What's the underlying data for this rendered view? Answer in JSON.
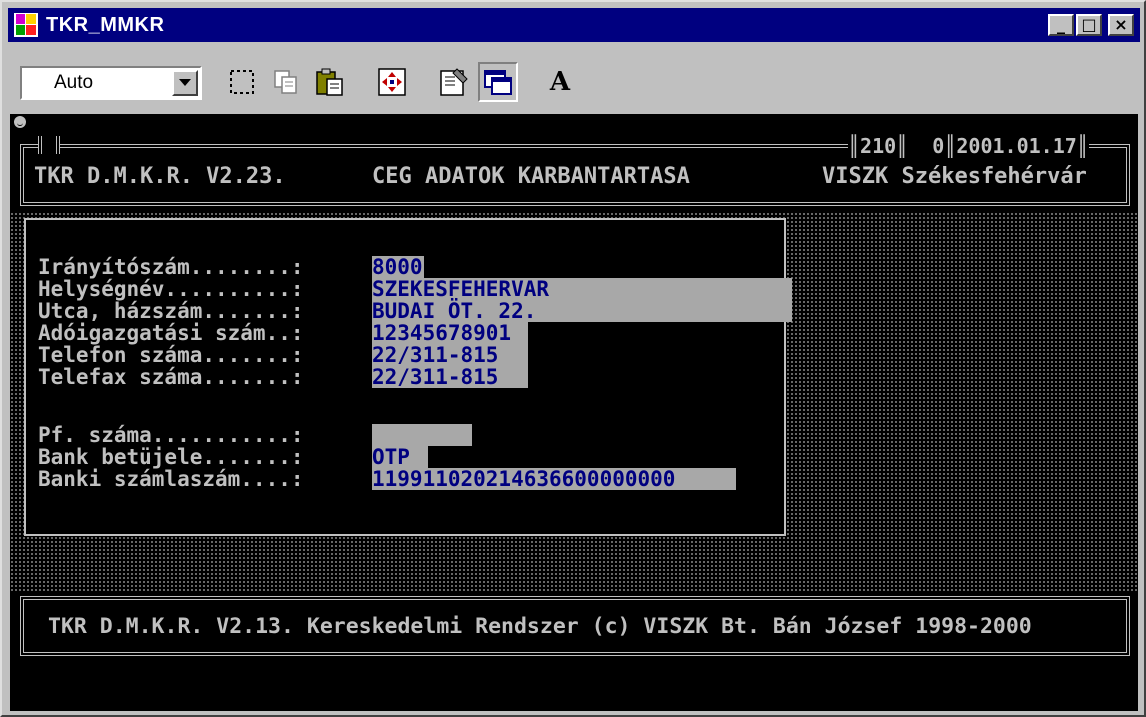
{
  "window": {
    "title": "TKR_MMKR",
    "minimize_glyph": "_",
    "maximize_glyph": "□",
    "close_glyph": "×"
  },
  "toolbar": {
    "font_combo_value": "Auto",
    "buttons": [
      {
        "name": "mark-icon"
      },
      {
        "name": "copy-icon"
      },
      {
        "name": "paste-icon"
      },
      {
        "name": "fullscreen-icon"
      },
      {
        "name": "properties-icon"
      },
      {
        "name": "background-icon",
        "pressed": true
      },
      {
        "name": "font-icon",
        "glyph": "A"
      }
    ]
  },
  "console": {
    "header": {
      "left": "TKR D.M.K.R. V2.23.",
      "center": "CEG ADATOK KARBANTARTASA",
      "right": "VISZK Székesfehérvár",
      "status": "║210║  0║2001.01.17║"
    },
    "form": {
      "rows": [
        {
          "label": "Irányítószám........:",
          "value": "8000"
        },
        {
          "label": "Helységnév..........:",
          "value": "SZEKESFEHERVAR"
        },
        {
          "label": "Utca, házszám.......:",
          "value": "BUDAI ÖT. 22."
        },
        {
          "label": "Adóigazgatási szám..:",
          "value": "12345678901"
        },
        {
          "label": "Telefon száma.......:",
          "value": "22/311-815"
        },
        {
          "label": "Telefax száma.......:",
          "value": "22/311-815"
        },
        {
          "label": "Pf. száma...........:",
          "value": ""
        },
        {
          "label": "Bank betüjele.......:",
          "value": "OTP"
        },
        {
          "label": "Banki számlaszám....:",
          "value": "119911020214636600000000"
        }
      ]
    },
    "footer": "TKR D.M.K.R. V2.13. Kereskedelmi Rendszer (c) VISZK Bt. Bán József 1998-2000"
  },
  "colors": {
    "titlebar": "#000080",
    "field_background": "#a8a8a8",
    "field_text": "#000080",
    "console_text": "#c0c0c0"
  }
}
